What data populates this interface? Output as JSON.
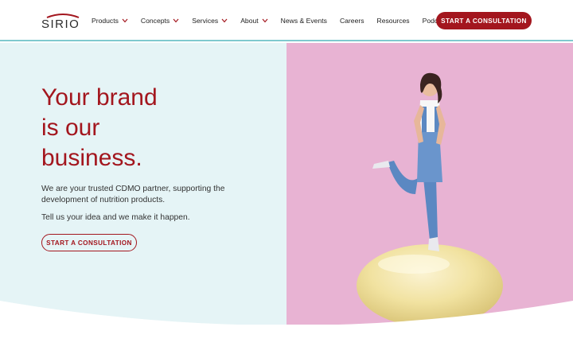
{
  "brand": {
    "name": "SIRIO",
    "accent": "#a3161e",
    "teal": "#7fc9cf"
  },
  "nav": {
    "items": [
      {
        "label": "Products",
        "has_dropdown": true
      },
      {
        "label": "Concepts",
        "has_dropdown": true
      },
      {
        "label": "Services",
        "has_dropdown": true
      },
      {
        "label": "About",
        "has_dropdown": true
      },
      {
        "label": "News & Events",
        "has_dropdown": false
      },
      {
        "label": "Careers",
        "has_dropdown": false
      },
      {
        "label": "Resources",
        "has_dropdown": false
      },
      {
        "label": "Podcast",
        "has_dropdown": false
      }
    ],
    "cta_label": "START A CONSULTATION"
  },
  "hero": {
    "title_lines": [
      "Your brand",
      "is our",
      "business."
    ],
    "paragraph_1": "We are your trusted CDMO partner, supporting the development of nutrition products.",
    "paragraph_2": "Tell us your idea and we make it happen.",
    "cta_label": "START A CONSULTATION",
    "left_bg": "#e5f4f6",
    "right_bg": "#e8b3d3"
  }
}
